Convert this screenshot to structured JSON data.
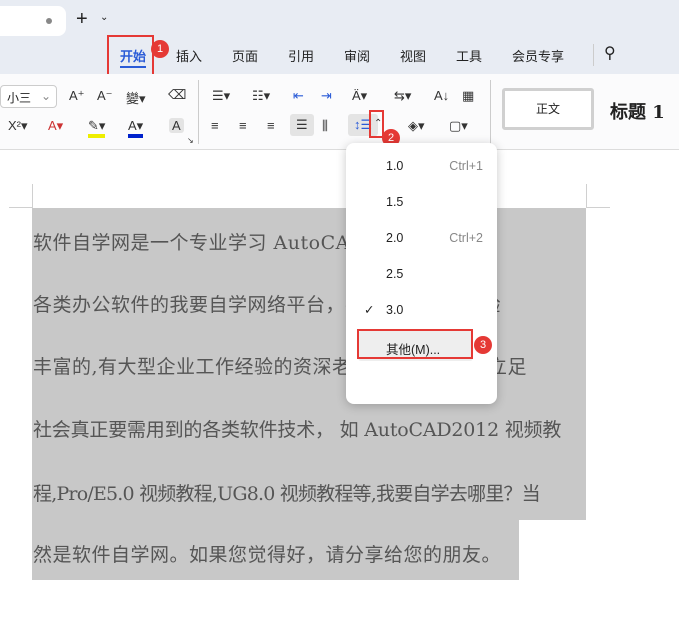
{
  "titlebar": {
    "new_tab": "+",
    "new_tab_menu": "⌄"
  },
  "ribbon_tabs": [
    "开始",
    "插入",
    "页面",
    "引用",
    "审阅",
    "视图",
    "工具",
    "会员专享"
  ],
  "font_size": "小三",
  "styles": {
    "normal": "正文",
    "heading1": "标题 1"
  },
  "callouts": [
    "1",
    "2",
    "3"
  ],
  "line_spacing_menu": {
    "items": [
      {
        "label": "1.0",
        "shortcut": "Ctrl+1"
      },
      {
        "label": "1.5",
        "shortcut": ""
      },
      {
        "label": "2.0",
        "shortcut": "Ctrl+2"
      },
      {
        "label": "2.5",
        "shortcut": ""
      },
      {
        "label": "3.0",
        "shortcut": "",
        "checked": true
      }
    ],
    "other": "其他(M)..."
  },
  "document": {
    "lines": [
      "软件自学网是一个专业学习 AutoCAD、天正建筑等",
      "各类办公软件的我要自学网络平台，视频教程均由经验",
      "丰富的,有大型企业工作经验的资深老师讲解，是大家立足",
      "社会真正要需用到的各类软件技术， 如 AutoCAD2012 视频教",
      "程,Pro/E5.0 视频教程,UG8.0 视频教程等,我要自学去哪里？当",
      "然是软件自学网。如果您觉得好，请分享给您的朋友。"
    ]
  }
}
